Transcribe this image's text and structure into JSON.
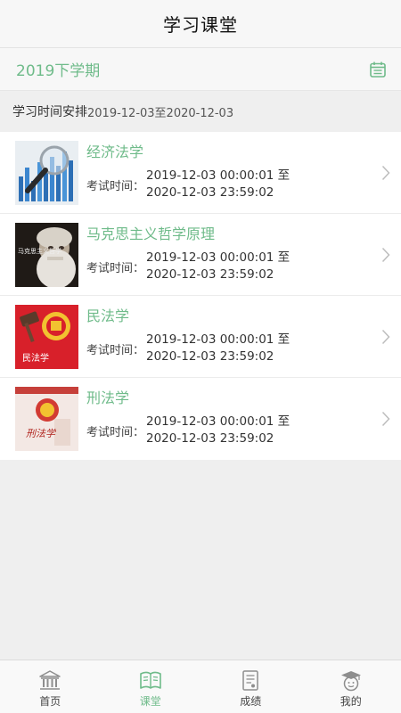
{
  "header": {
    "title": "学习课堂"
  },
  "semester": {
    "label": "2019下学期",
    "icon": "calendar-icon"
  },
  "schedule": {
    "label": "学习时间安排",
    "range": "2019-12-03至2020-12-03"
  },
  "courses": [
    {
      "name": "经济法学",
      "time_label": "考试时间：",
      "start": "2019-12-03 00:00:01 至",
      "end": "2020-12-03 23:59:02"
    },
    {
      "name": "马克思主义哲学原理",
      "time_label": "考试时间：",
      "start": "2019-12-03 00:00:01 至",
      "end": "2020-12-03 23:59:02",
      "thumb_text": "马克思主义哲学"
    },
    {
      "name": "民法学",
      "time_label": "考试时间：",
      "start": "2019-12-03 00:00:01 至",
      "end": "2020-12-03 23:59:02",
      "thumb_text": "民法学"
    },
    {
      "name": "刑法学",
      "time_label": "考试时间：",
      "start": "2019-12-03 00:00:01 至",
      "end": "2020-12-03 23:59:02",
      "thumb_text": "刑法学"
    }
  ],
  "tabs": [
    {
      "label": "首页",
      "icon": "home-bank-icon",
      "active": false
    },
    {
      "label": "课堂",
      "icon": "book-icon",
      "active": true
    },
    {
      "label": "成绩",
      "icon": "report-icon",
      "active": false
    },
    {
      "label": "我的",
      "icon": "graduate-avatar-icon",
      "active": false
    }
  ],
  "colors": {
    "accent": "#6fbb8a",
    "background": "#efefef",
    "bar": "#f7f7f7"
  }
}
